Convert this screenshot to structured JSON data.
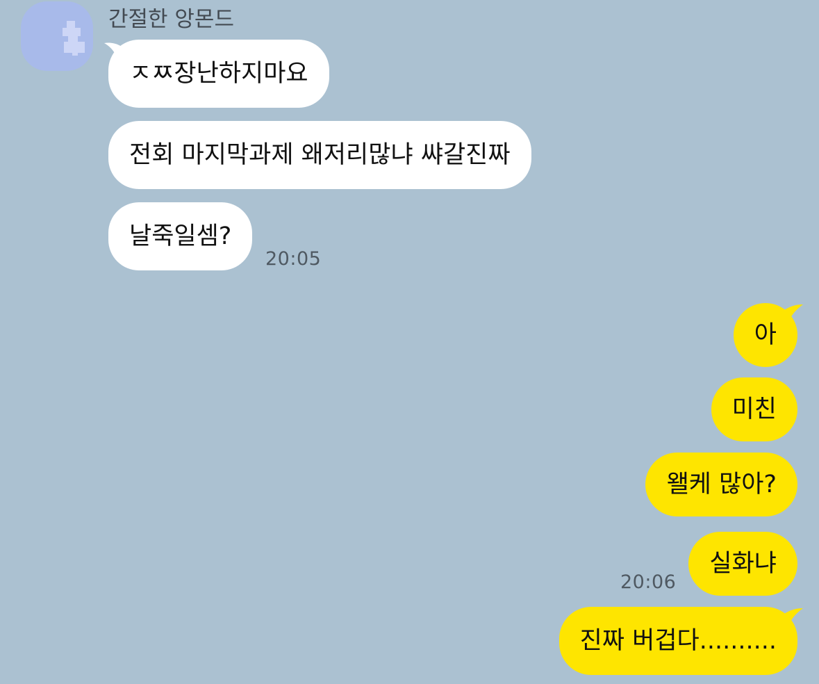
{
  "chat": {
    "sender_name": "간절한 앙몬드",
    "incoming": [
      {
        "text": "ㅈㅉ장난하지마요"
      },
      {
        "text": "전회 마지막과제 왜저리많냐 쌰갈진짜"
      },
      {
        "text": "날죽일셈?"
      }
    ],
    "incoming_time": "20:05",
    "outgoing": [
      {
        "text": "아"
      },
      {
        "text": "미친"
      },
      {
        "text": "왤케 많아?"
      },
      {
        "text": "실화냐"
      },
      {
        "text": "진짜 버겁다.........."
      }
    ],
    "outgoing_time": "20:06"
  },
  "colors": {
    "background": "#abc1d1",
    "incoming_bubble": "#ffffff",
    "outgoing_bubble": "#fee500"
  },
  "icons": {
    "avatar": "pixelated-profile-avatar",
    "incoming_tail": "speech-bubble-tail-left",
    "outgoing_tail": "speech-bubble-tail-right"
  }
}
